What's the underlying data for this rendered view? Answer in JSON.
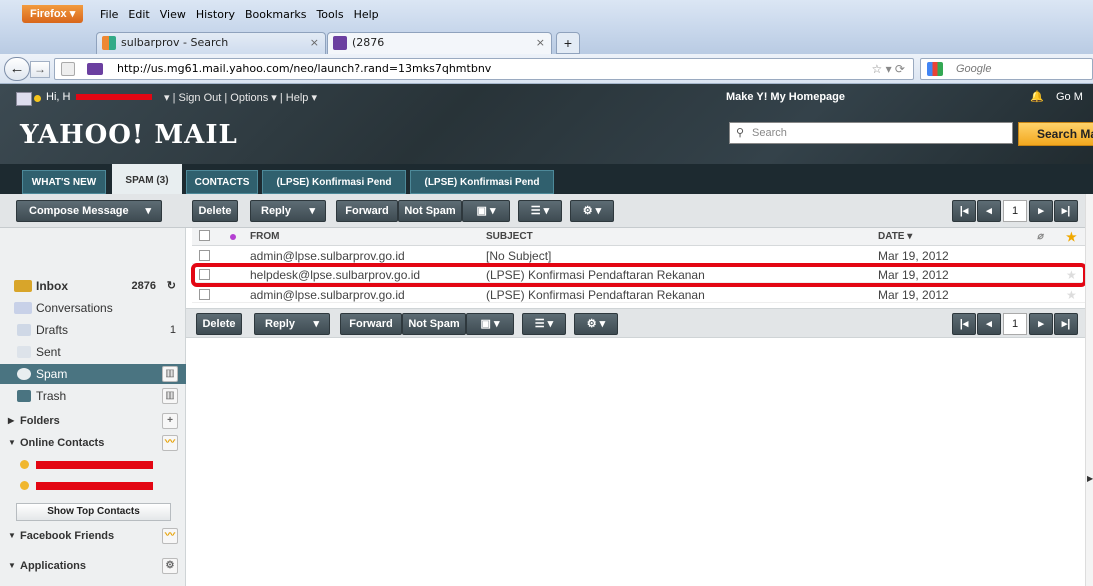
{
  "browser": {
    "firefox_button": "Firefox",
    "menus": [
      "File",
      "Edit",
      "View",
      "History",
      "Bookmarks",
      "Tools",
      "Help"
    ],
    "tabs": [
      {
        "title": "sulbarprov - Search"
      },
      {
        "title": "(2876"
      }
    ],
    "url": "http://us.mg61.mail.yahoo.com/neo/launch?.rand=13mks7qhmtbnv",
    "search_placeholder": "Google"
  },
  "header": {
    "greeting": "Hi, H",
    "nav_sign_out": "Sign Out",
    "nav_options": "Options",
    "nav_help": "Help",
    "make_homepage": "Make Y! My Homepage",
    "go_mail": "Go M",
    "logo": "YAHOO! MAIL",
    "search_placeholder": "Search",
    "search_button": "Search Ma",
    "tabs": [
      "WHAT'S NEW",
      "SPAM (3)",
      "CONTACTS",
      "(LPSE) Konfirmasi Pend",
      "(LPSE) Konfirmasi Pend"
    ]
  },
  "toolbar": {
    "compose": "Compose Message",
    "delete": "Delete",
    "reply": "Reply",
    "forward": "Forward",
    "not_spam": "Not Spam",
    "page": "1"
  },
  "sidebar": {
    "items": [
      {
        "label": "Inbox",
        "count": "2876"
      },
      {
        "label": "Conversations",
        "count": ""
      },
      {
        "label": "Drafts",
        "count": "1"
      },
      {
        "label": "Sent",
        "count": ""
      },
      {
        "label": "Spam",
        "count": ""
      },
      {
        "label": "Trash",
        "count": ""
      }
    ],
    "folders": "Folders",
    "online_contacts": "Online Contacts",
    "show_top_contacts": "Show Top Contacts",
    "facebook_friends": "Facebook Friends",
    "applications": "Applications"
  },
  "list": {
    "headers": {
      "from": "FROM",
      "subject": "SUBJECT",
      "date": "DATE"
    },
    "rows": [
      {
        "from": "admin@lpse.sulbarprov.go.id",
        "subject": "[No Subject]",
        "date": "Mar 19, 2012"
      },
      {
        "from": "helpdesk@lpse.sulbarprov.go.id",
        "subject": "(LPSE) Konfirmasi Pendaftaran Rekanan",
        "date": "Mar 19, 2012"
      },
      {
        "from": "admin@lpse.sulbarprov.go.id",
        "subject": "(LPSE) Konfirmasi Pendaftaran Rekanan",
        "date": "Mar 19, 2012"
      }
    ]
  }
}
